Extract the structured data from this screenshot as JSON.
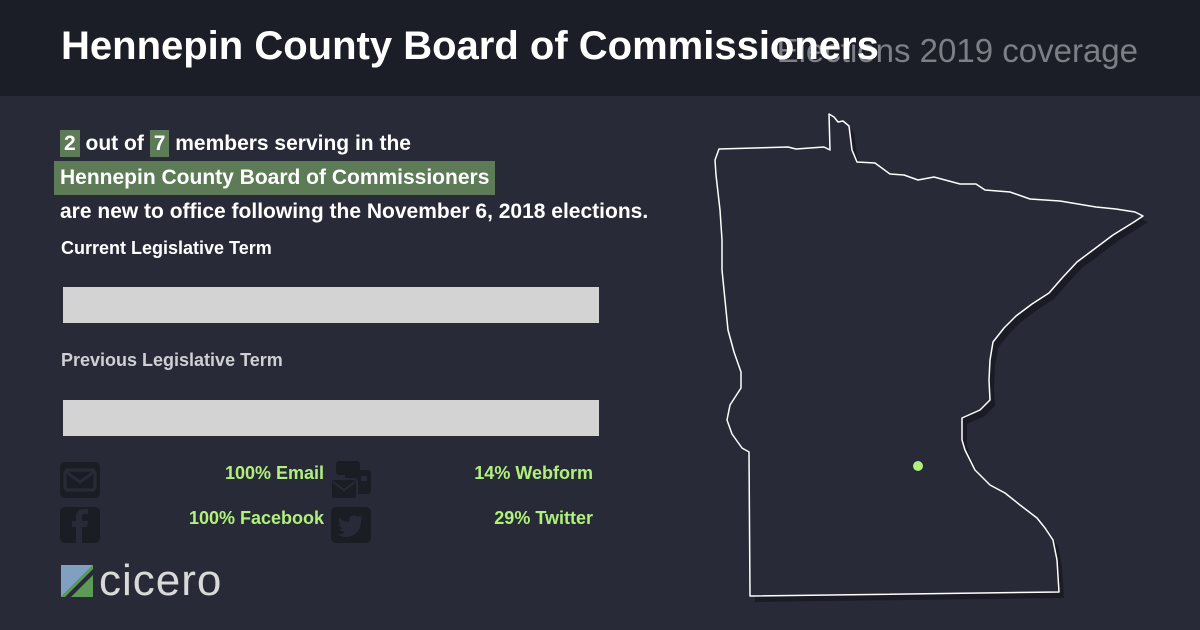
{
  "header": {
    "title": "Hennepin County Board of Commissioners",
    "subtitle": "Elections 2019 coverage"
  },
  "summary": {
    "new_count": "2",
    "out_of": "out of",
    "total_count": "7",
    "members_text": "members serving in the",
    "body_name": "Hennepin County Board of Commissioners",
    "tail": "are new to office following the November 6, 2018 elections."
  },
  "terms": {
    "current_label": "Current Legislative Term",
    "previous_label": "Previous Legislative Term"
  },
  "channels": [
    {
      "label": "100% Email",
      "icon": "envelope-icon"
    },
    {
      "label": "14% Webform",
      "icon": "webform-icon"
    },
    {
      "label": "100% Facebook",
      "icon": "facebook-icon"
    },
    {
      "label": "29% Twitter",
      "icon": "twitter-icon"
    }
  ],
  "logo": {
    "text": "cicero"
  },
  "colors": {
    "background": "#282a38",
    "header": "#1c1e27",
    "highlight": "#5d7b56",
    "accent": "#b0f07c",
    "bar": "#d3d3d3"
  }
}
